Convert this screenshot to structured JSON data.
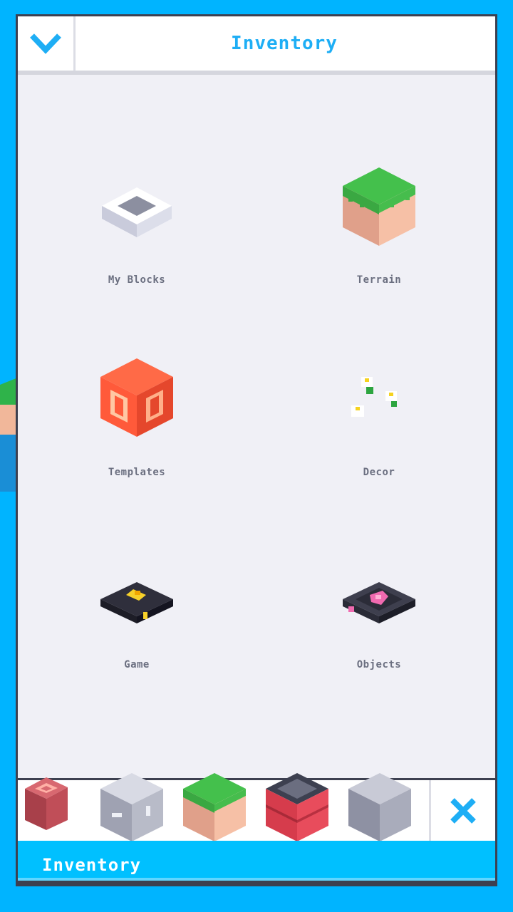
{
  "header": {
    "title": "Inventory",
    "back_icon": "chevron-down-icon"
  },
  "categories": [
    {
      "label": "My Blocks",
      "icon": "my-blocks-icon"
    },
    {
      "label": "Terrain",
      "icon": "terrain-icon"
    },
    {
      "label": "Templates",
      "icon": "templates-icon"
    },
    {
      "label": "Decor",
      "icon": "decor-icon"
    },
    {
      "label": "Game",
      "icon": "game-icon"
    },
    {
      "label": "Objects",
      "icon": "objects-icon"
    }
  ],
  "hotbar": {
    "slots": [
      "red-block-icon",
      "gray-cabinet-block-icon",
      "grass-block-icon",
      "brick-block-icon",
      "gray-block-icon"
    ],
    "close_icon": "close-icon"
  },
  "tab": {
    "label": "Inventory"
  },
  "colors": {
    "accent": "#1eaef5",
    "background": "#00b4ff",
    "panel": "#f0f0f6",
    "border": "#3d4050"
  }
}
